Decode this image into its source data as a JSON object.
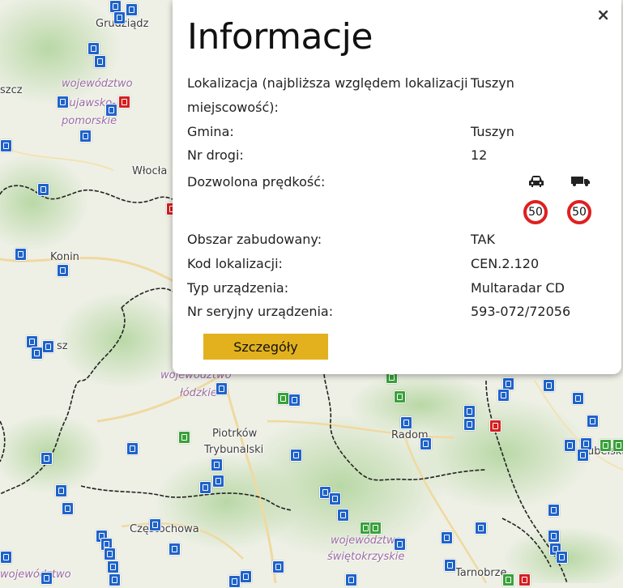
{
  "popup": {
    "close_label": "×",
    "title": "Informacje",
    "location_label_1": "Lokalizacja (najbliższa względem lokalizacji",
    "location_label_2": "miejscowość):",
    "location_value": "Tuszyn",
    "commune_label": "Gmina:",
    "commune_value": "Tuszyn",
    "road_label": "Nr drogi:",
    "road_value": "12",
    "speed_label": "Dozwolona prędkość:",
    "speed_car": "50",
    "speed_truck": "50",
    "speed_car_icon": "car-icon",
    "speed_truck_icon": "truck-icon",
    "built_area_label": "Obszar zabudowany:",
    "built_area_value": "TAK",
    "location_code_label": "Kod lokalizacji:",
    "location_code_value": "CEN.2.120",
    "device_type_label": "Typ urządzenia:",
    "device_type_value": "Multaradar CD",
    "serial_label": "Nr seryjny urządzenia:",
    "serial_value": "593-072/72056",
    "details_button": "Szczegóły"
  },
  "map": {
    "places": {
      "grudziadz": "Grudziądz",
      "szcz": "szcz",
      "wloclawek": "Włocła",
      "konin": "Konin",
      "sz": "sz",
      "piotrkow_1": "Piotrków",
      "piotrkow_2": "Trybunalski",
      "radom": "Radom",
      "czestochowa": "Częstochowa",
      "tarnobrzeg": "Tarnobrze",
      "lubelskie": "ubelskie"
    },
    "regions": {
      "kujawsko_1": "województwo",
      "kujawsko_2": "kujawsko-",
      "kujawsko_3": "pomorskie",
      "lodzkie_1": "województwo",
      "lodzkie_2": "łódzkie",
      "swietokrzyskie_1": "województwo",
      "swietokrzyskie_2": "świętokrzyskie",
      "slaskie": "województwo"
    },
    "colors": {
      "marker_blue": "#1f63c9",
      "marker_green": "#3aa13a",
      "marker_red": "#d42020",
      "button": "#e2b11d",
      "sign_border": "#e01f1f"
    }
  }
}
